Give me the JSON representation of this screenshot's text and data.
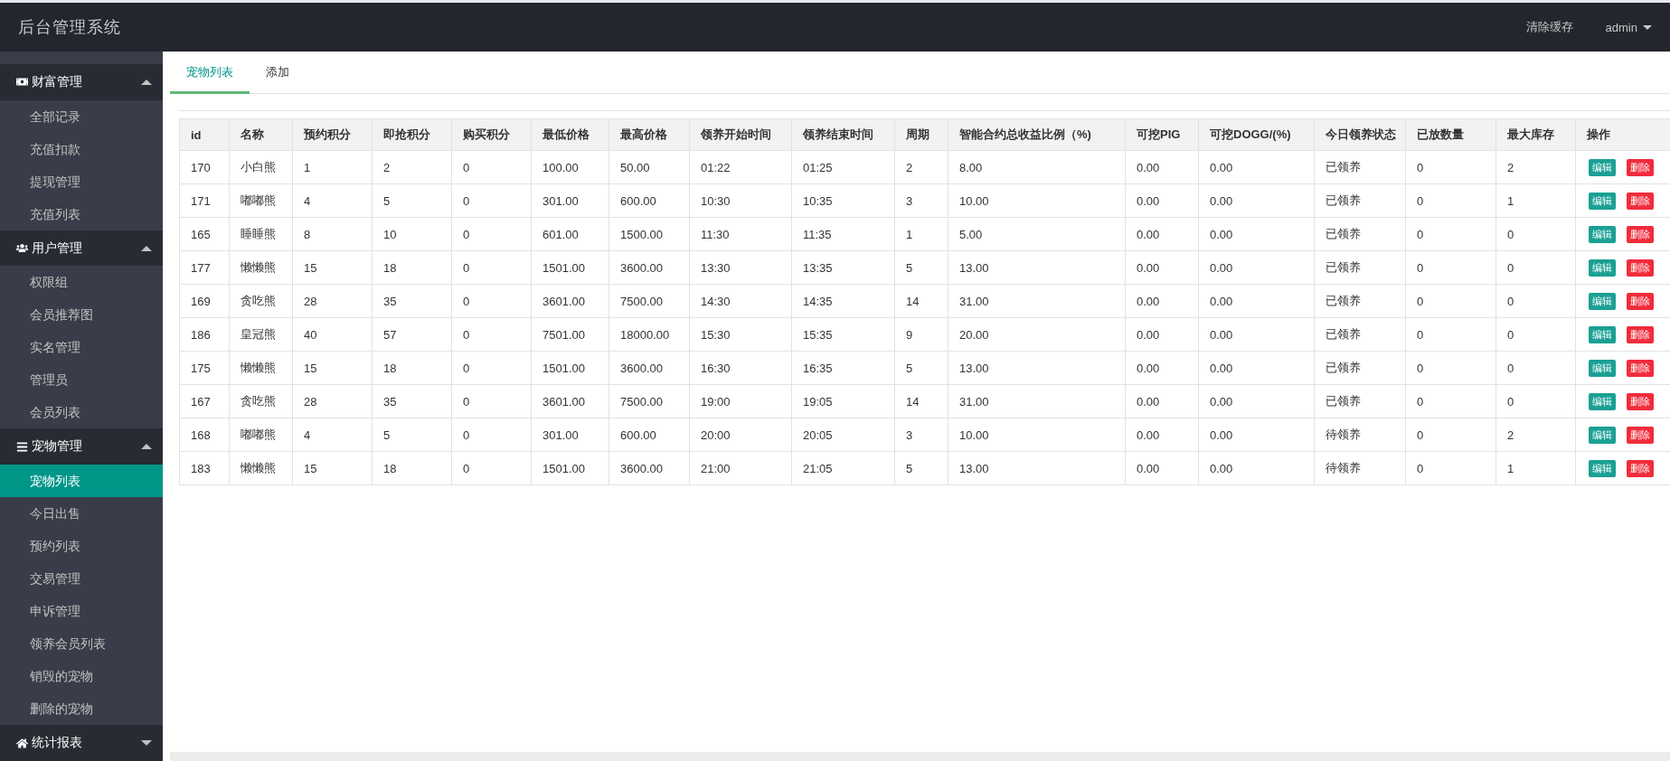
{
  "header": {
    "title": "后台管理系统",
    "links": [
      {
        "label": "清除缓存",
        "kind": "link"
      },
      {
        "label": "admin",
        "kind": "dropdown"
      }
    ]
  },
  "sidebar": {
    "groups": [
      {
        "label": "财富管理",
        "expanded": true,
        "items": [
          {
            "label": "全部记录",
            "selected": false
          },
          {
            "label": "充值扣款",
            "selected": false
          },
          {
            "label": "提现管理",
            "selected": false
          },
          {
            "label": "充值列表",
            "selected": false
          }
        ]
      },
      {
        "label": "用户管理",
        "expanded": true,
        "items": [
          {
            "label": "权限组",
            "selected": false
          },
          {
            "label": "会员推荐图",
            "selected": false
          },
          {
            "label": "实名管理",
            "selected": false
          },
          {
            "label": "管理员",
            "selected": false
          },
          {
            "label": "会员列表",
            "selected": false
          }
        ]
      },
      {
        "label": "宠物管理",
        "expanded": true,
        "items": [
          {
            "label": "宠物列表",
            "selected": true
          },
          {
            "label": "今日出售",
            "selected": false
          },
          {
            "label": "预约列表",
            "selected": false
          },
          {
            "label": "交易管理",
            "selected": false
          },
          {
            "label": "申诉管理",
            "selected": false
          },
          {
            "label": "领养会员列表",
            "selected": false
          },
          {
            "label": "销毁的宠物",
            "selected": false
          },
          {
            "label": "删除的宠物",
            "selected": false
          }
        ]
      },
      {
        "label": "统计报表",
        "expanded": false
      }
    ]
  },
  "tabs": [
    {
      "label": "宠物列表",
      "selected": true
    },
    {
      "label": "添加",
      "selected": false
    }
  ],
  "table": {
    "columns": [
      "id",
      "名称",
      "预约积分",
      "即抢积分",
      "购买积分",
      "最低价格",
      "最高价格",
      "领养开始时间",
      "领养结束时间",
      "周期",
      "智能合约总收益比例（%)",
      "可挖PIG",
      "可挖DOGG/(%)",
      "今日领养状态",
      "已放数量",
      "最大库存",
      "操作"
    ],
    "rows": [
      {
        "cells": [
          "170",
          "小白熊",
          "1",
          "2",
          "0",
          "100.00",
          "50.00",
          "01:22",
          "01:25",
          "2",
          "8.00",
          "0.00",
          "0.00",
          "已领养",
          "0",
          "2"
        ],
        "actions": [
          {
            "label": "编辑",
            "kind": "edit"
          },
          {
            "label": "删除",
            "kind": "delete"
          }
        ]
      },
      {
        "cells": [
          "171",
          "嘟嘟熊",
          "4",
          "5",
          "0",
          "301.00",
          "600.00",
          "10:30",
          "10:35",
          "3",
          "10.00",
          "0.00",
          "0.00",
          "已领养",
          "0",
          "1"
        ],
        "actions": [
          {
            "label": "编辑",
            "kind": "edit"
          },
          {
            "label": "删除",
            "kind": "delete"
          }
        ]
      },
      {
        "cells": [
          "165",
          "睡睡熊",
          "8",
          "10",
          "0",
          "601.00",
          "1500.00",
          "11:30",
          "11:35",
          "1",
          "5.00",
          "0.00",
          "0.00",
          "已领养",
          "0",
          "0"
        ],
        "actions": [
          {
            "label": "编辑",
            "kind": "edit"
          },
          {
            "label": "删除",
            "kind": "delete"
          }
        ]
      },
      {
        "cells": [
          "177",
          "懒懒熊",
          "15",
          "18",
          "0",
          "1501.00",
          "3600.00",
          "13:30",
          "13:35",
          "5",
          "13.00",
          "0.00",
          "0.00",
          "已领养",
          "0",
          "0"
        ],
        "actions": [
          {
            "label": "编辑",
            "kind": "edit"
          },
          {
            "label": "删除",
            "kind": "delete"
          }
        ]
      },
      {
        "cells": [
          "169",
          "贪吃熊",
          "28",
          "35",
          "0",
          "3601.00",
          "7500.00",
          "14:30",
          "14:35",
          "14",
          "31.00",
          "0.00",
          "0.00",
          "已领养",
          "0",
          "0"
        ],
        "actions": [
          {
            "label": "编辑",
            "kind": "edit"
          },
          {
            "label": "删除",
            "kind": "delete"
          }
        ]
      },
      {
        "cells": [
          "186",
          "皇冠熊",
          "40",
          "57",
          "0",
          "7501.00",
          "18000.00",
          "15:30",
          "15:35",
          "9",
          "20.00",
          "0.00",
          "0.00",
          "已领养",
          "0",
          "0"
        ],
        "actions": [
          {
            "label": "编辑",
            "kind": "edit"
          },
          {
            "label": "删除",
            "kind": "delete"
          }
        ]
      },
      {
        "cells": [
          "175",
          "懒懒熊",
          "15",
          "18",
          "0",
          "1501.00",
          "3600.00",
          "16:30",
          "16:35",
          "5",
          "13.00",
          "0.00",
          "0.00",
          "已领养",
          "0",
          "0"
        ],
        "actions": [
          {
            "label": "编辑",
            "kind": "edit"
          },
          {
            "label": "删除",
            "kind": "delete"
          }
        ]
      },
      {
        "cells": [
          "167",
          "贪吃熊",
          "28",
          "35",
          "0",
          "3601.00",
          "7500.00",
          "19:00",
          "19:05",
          "14",
          "31.00",
          "0.00",
          "0.00",
          "已领养",
          "0",
          "0"
        ],
        "actions": [
          {
            "label": "编辑",
            "kind": "edit"
          },
          {
            "label": "删除",
            "kind": "delete"
          }
        ]
      },
      {
        "cells": [
          "168",
          "嘟嘟熊",
          "4",
          "5",
          "0",
          "301.00",
          "600.00",
          "20:00",
          "20:05",
          "3",
          "10.00",
          "0.00",
          "0.00",
          "待领养",
          "0",
          "2"
        ],
        "actions": [
          {
            "label": "编辑",
            "kind": "edit"
          },
          {
            "label": "删除",
            "kind": "delete"
          }
        ]
      },
      {
        "cells": [
          "183",
          "懒懒熊",
          "15",
          "18",
          "0",
          "1501.00",
          "3600.00",
          "21:00",
          "21:05",
          "5",
          "13.00",
          "0.00",
          "0.00",
          "待领养",
          "0",
          "1"
        ],
        "actions": [
          {
            "label": "编辑",
            "kind": "edit"
          },
          {
            "label": "删除",
            "kind": "delete"
          }
        ]
      }
    ]
  }
}
